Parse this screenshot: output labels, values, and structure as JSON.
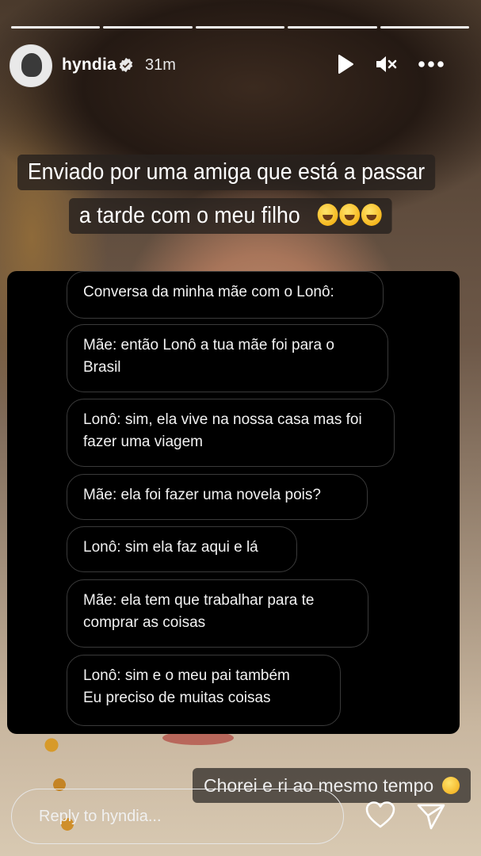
{
  "story": {
    "segments": 5,
    "author": {
      "username": "hyndia",
      "verified": true,
      "posted_ago": "31m"
    },
    "controls": {
      "play": "play-icon",
      "mute": "muted-speaker-icon",
      "more": "more-horizontal-icon"
    },
    "caption": {
      "line1": "Enviado por uma amiga que está a passar",
      "line2": "a tarde com o meu filho",
      "emoji": "🤣🤣🤣"
    },
    "chat": {
      "messages": [
        {
          "text": "Conversa da minha mãe com o Lonô:"
        },
        {
          "text": "Mãe: então Lonô a tua mãe foi para o Brasil"
        },
        {
          "text": "Lonô: sim, ela vive na nossa casa mas foi fazer uma viagem"
        },
        {
          "text": "Mãe: ela foi fazer uma novela pois?"
        },
        {
          "text": "Lonô: sim ela faz aqui e lá"
        },
        {
          "text": "Mãe: ela tem que trabalhar para te comprar as coisas"
        },
        {
          "text": "Lonô: sim e o meu pai também\nEu preciso de muitas coisas"
        }
      ]
    },
    "sticker": {
      "text": "Chorei e ri ao mesmo tempo",
      "emoji": "🥺"
    },
    "reply": {
      "placeholder": "Reply to hyndia..."
    },
    "actions": {
      "like": "heart-icon",
      "send": "send-icon"
    }
  },
  "colors": {
    "text": "#ffffff",
    "card": "#000000",
    "bubble_border": "#3a3a3a"
  }
}
